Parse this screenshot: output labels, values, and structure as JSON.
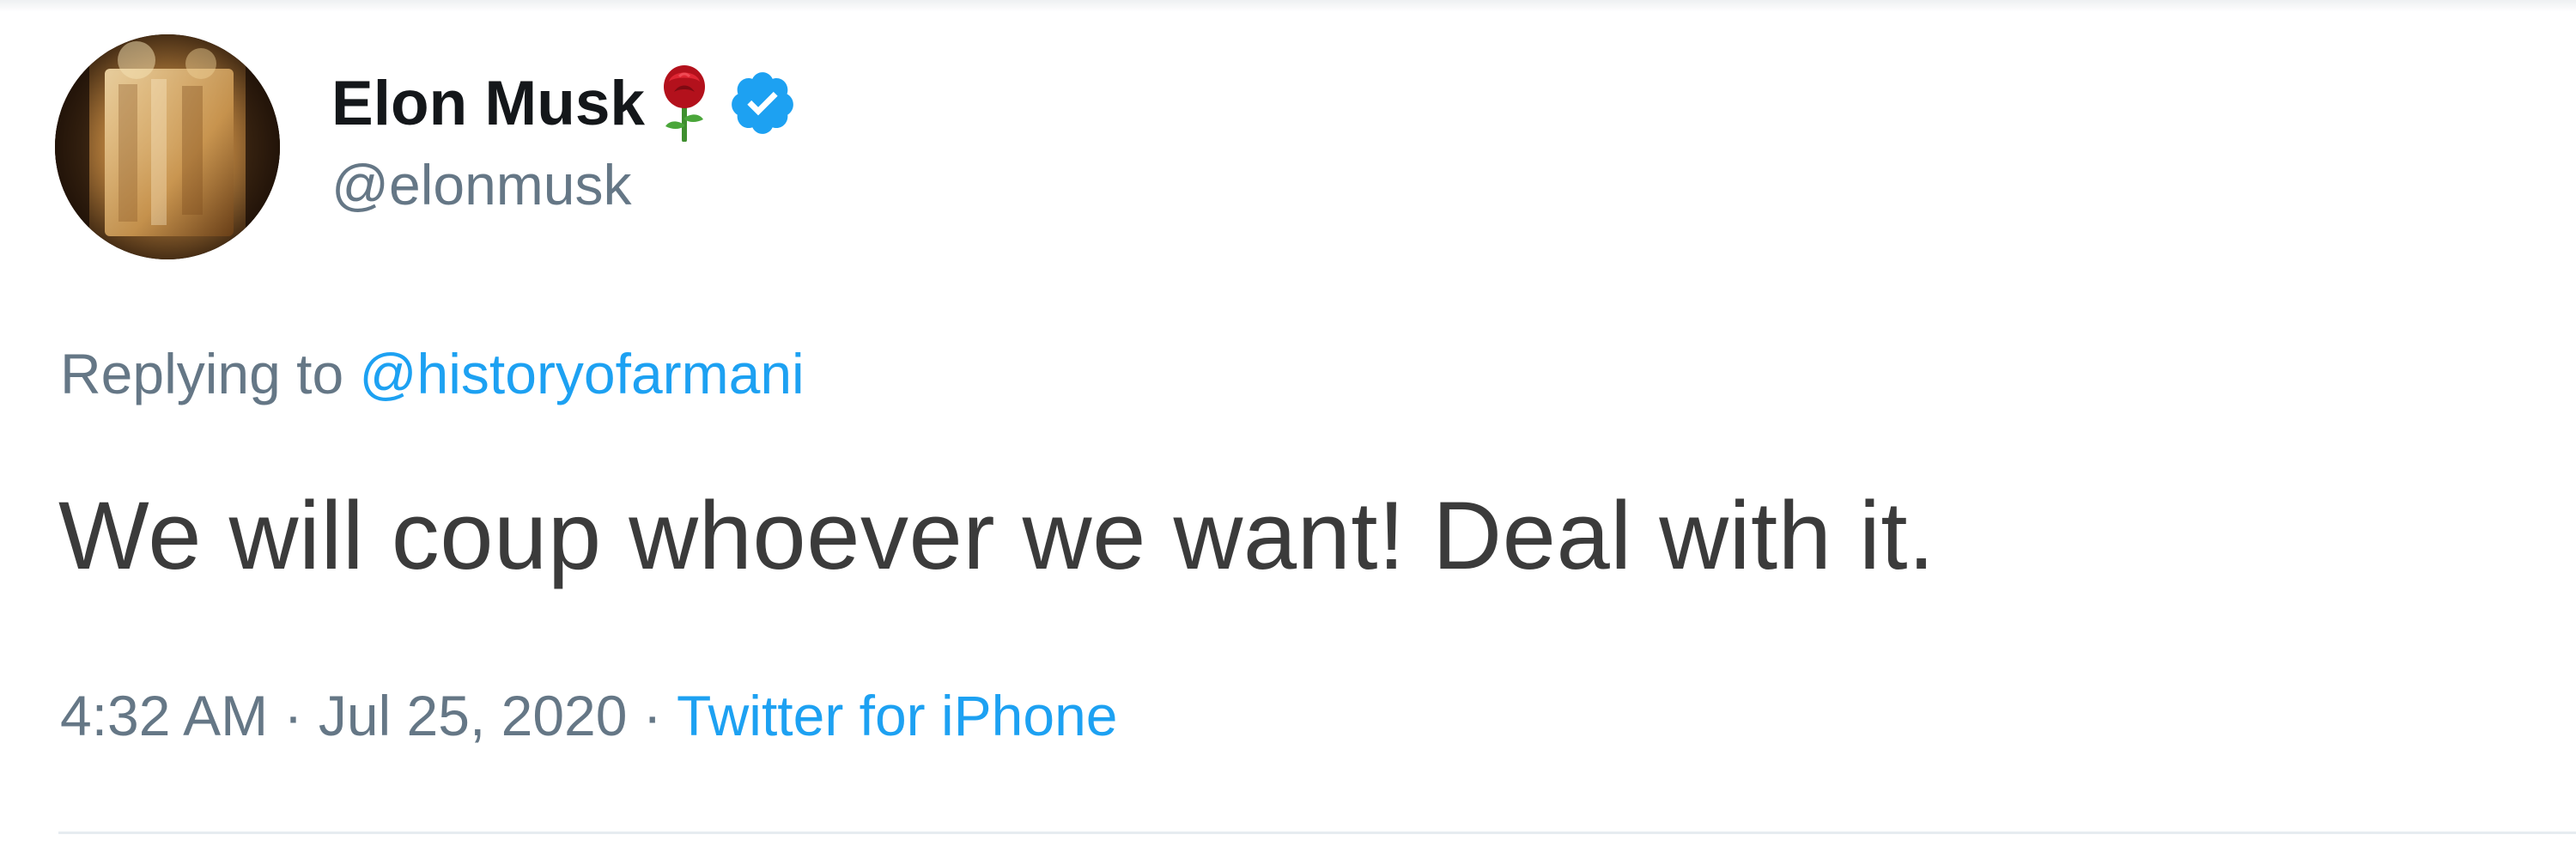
{
  "author": {
    "display_name": "Elon Musk",
    "handle": "@elonmusk",
    "emoji_icon": "rose-icon",
    "verified_icon": "verified-badge-icon",
    "verified_color": "#1da1f2"
  },
  "reply": {
    "prefix": "Replying to",
    "mention": "@historyofarmani"
  },
  "tweet": {
    "text": "We will coup whoever we want! Deal with it."
  },
  "meta": {
    "time": "4:32 AM",
    "separator": "·",
    "date": "Jul 25, 2020",
    "source": "Twitter for iPhone"
  },
  "colors": {
    "link": "#1da1f2",
    "secondary_text": "#657786",
    "primary_text": "#14171a",
    "divider": "#e6ecf0"
  }
}
